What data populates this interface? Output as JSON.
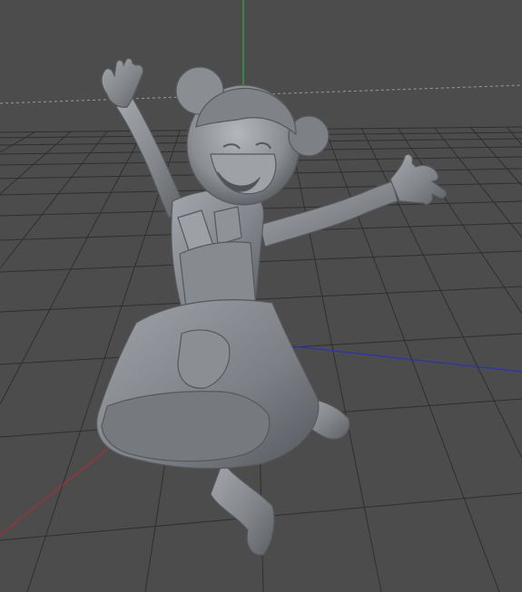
{
  "viewport": {
    "mode": "perspective",
    "background_color": "#4c4c4c",
    "grid_color": "#2f2f2f",
    "horizon_color": "#9a9a9a",
    "axis_colors": {
      "x": "#c1272d",
      "y": "#22c03a",
      "z": "#1f2fd1"
    }
  },
  "model": {
    "icon": "jumping-girl-sculpt",
    "material_color": "#8d9196",
    "shadow_color": "#5d6166",
    "highlight_color": "#b5b9bd"
  }
}
